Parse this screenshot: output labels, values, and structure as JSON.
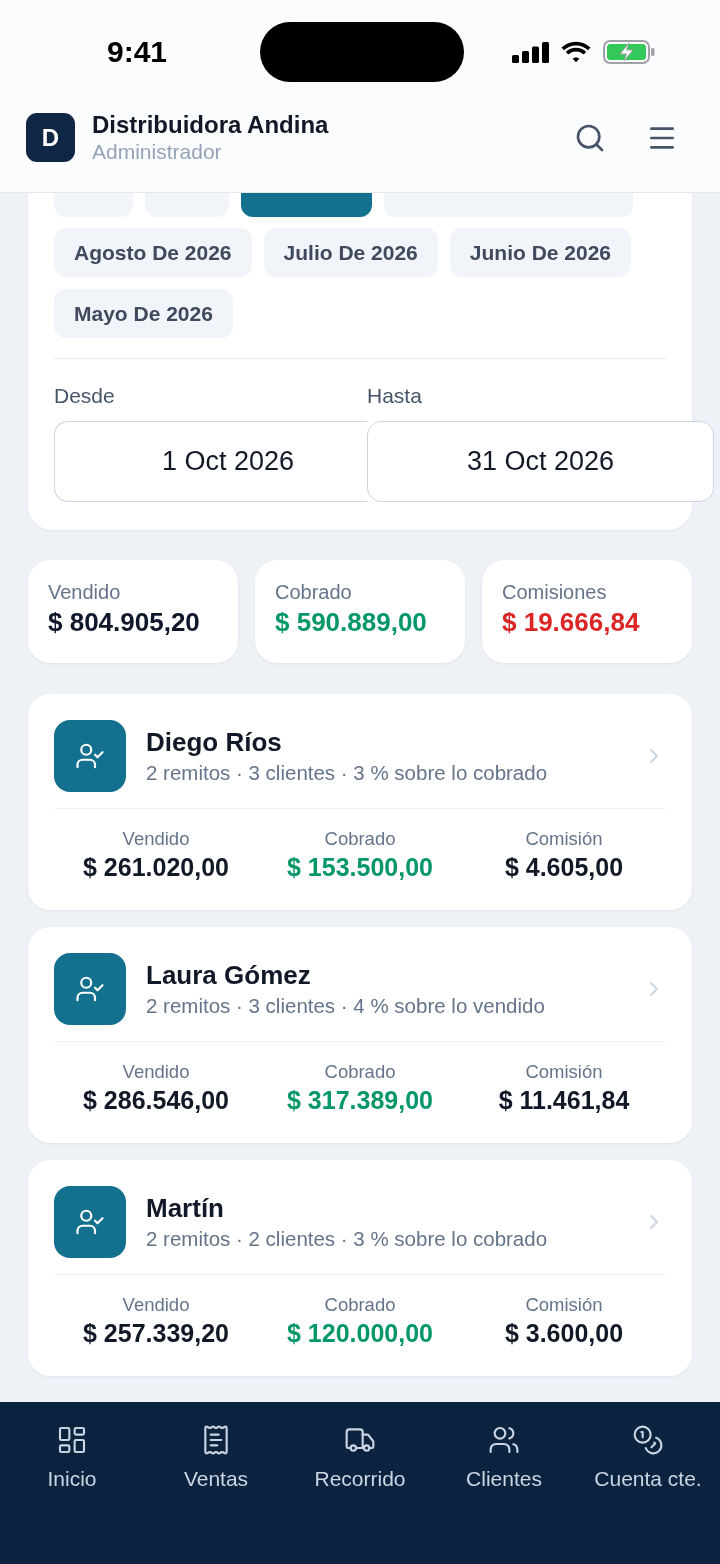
{
  "status_bar": {
    "time": "9:41"
  },
  "header": {
    "logo": "D",
    "title": "Distribuidora Andina",
    "subtitle": "Administrador"
  },
  "period_filter": {
    "chips": [
      {
        "selected": false
      },
      {
        "selected": false
      },
      {
        "selected": true
      },
      {
        "selected": false
      },
      {
        "label": "Agosto De 2026",
        "selected": false
      },
      {
        "label": "Julio De 2026",
        "selected": false
      },
      {
        "label": "Junio De 2026",
        "selected": false
      },
      {
        "label": "Mayo De 2026",
        "selected": false
      }
    ],
    "from": {
      "label": "Desde",
      "value": "1 Oct 2026"
    },
    "to": {
      "label": "Hasta",
      "value": "31 Oct 2026"
    }
  },
  "summary": [
    {
      "label": "Vendido",
      "value": "$ 804.905,20",
      "color": "#0f172a"
    },
    {
      "label": "Cobrado",
      "value": "$ 590.889,00",
      "color": "#059669"
    },
    {
      "label": "Comisiones",
      "value": "$ 19.666,84",
      "color": "#dc2626"
    }
  ],
  "sellers": [
    {
      "name": "Diego Ríos",
      "details": "2 remitos · 3 clientes · 3 % sobre lo cobrado",
      "metrics": [
        {
          "label": "Vendido",
          "value": "$ 261.020,00",
          "color": "#111827"
        },
        {
          "label": "Cobrado",
          "value": "$ 153.500,00",
          "color": "#059669"
        },
        {
          "label": "Comisión",
          "value": "$ 4.605,00",
          "color": "#111827"
        }
      ]
    },
    {
      "name": "Laura Gómez",
      "details": "2 remitos · 3 clientes · 4 % sobre lo vendido",
      "metrics": [
        {
          "label": "Vendido",
          "value": "$ 286.546,00",
          "color": "#111827"
        },
        {
          "label": "Cobrado",
          "value": "$ 317.389,00",
          "color": "#059669"
        },
        {
          "label": "Comisión",
          "value": "$ 11.461,84",
          "color": "#111827"
        }
      ]
    },
    {
      "name": "Martín",
      "details": "2 remitos · 2 clientes · 3 % sobre lo cobrado",
      "metrics": [
        {
          "label": "Vendido",
          "value": "$ 257.339,20",
          "color": "#111827"
        },
        {
          "label": "Cobrado",
          "value": "$ 120.000,00",
          "color": "#059669"
        },
        {
          "label": "Comisión",
          "value": "$ 3.600,00",
          "color": "#111827"
        }
      ]
    }
  ],
  "bottom_nav": [
    {
      "label": "Inicio"
    },
    {
      "label": "Ventas"
    },
    {
      "label": "Recorrido"
    },
    {
      "label": "Clientes"
    },
    {
      "label": "Cuenta cte."
    }
  ]
}
